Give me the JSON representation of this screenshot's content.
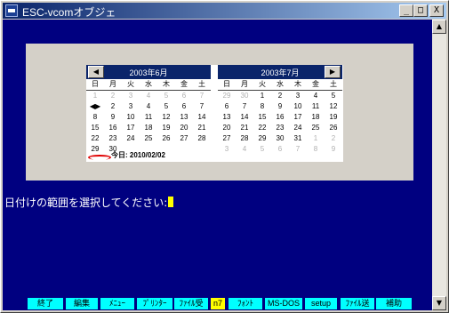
{
  "window": {
    "title": "ESC-vcomオブジェ",
    "min_glyph": "_",
    "max_glyph": "□",
    "close_glyph": "X"
  },
  "calendar": {
    "prev_glyph": "◀",
    "next_glyph": "▶",
    "weekdays": [
      "日",
      "月",
      "火",
      "水",
      "木",
      "金",
      "土"
    ],
    "months": [
      {
        "title": "2003年6月",
        "days": [
          {
            "d": "1"
          },
          {
            "d": "2"
          },
          {
            "d": "3"
          },
          {
            "d": "4"
          },
          {
            "d": "5"
          },
          {
            "d": "6"
          },
          {
            "d": "7"
          },
          {
            "d": "◀▶"
          },
          {
            "d": "2"
          },
          {
            "d": "3"
          },
          {
            "d": "4"
          },
          {
            "d": "5"
          },
          {
            "d": "6"
          },
          {
            "d": "7"
          },
          {
            "d": "8"
          },
          {
            "d": "9"
          },
          {
            "d": "10"
          },
          {
            "d": "11"
          },
          {
            "d": "12"
          },
          {
            "d": "13"
          },
          {
            "d": "14"
          },
          {
            "d": "15"
          },
          {
            "d": "16"
          },
          {
            "d": "17"
          },
          {
            "d": "18"
          },
          {
            "d": "19"
          },
          {
            "d": "20"
          },
          {
            "d": "21"
          },
          {
            "d": "22"
          },
          {
            "d": "23"
          },
          {
            "d": "24"
          },
          {
            "d": "25"
          },
          {
            "d": "26"
          },
          {
            "d": "27"
          },
          {
            "d": "28"
          },
          {
            "d": "29"
          },
          {
            "d": "30"
          }
        ],
        "dim_first_row": true
      },
      {
        "title": "2003年7月",
        "days": [
          {
            "d": "29"
          },
          {
            "d": "30"
          },
          {
            "d": "1"
          },
          {
            "d": "2"
          },
          {
            "d": "3"
          },
          {
            "d": "4"
          },
          {
            "d": "5"
          },
          {
            "d": "6"
          },
          {
            "d": "7"
          },
          {
            "d": "8"
          },
          {
            "d": "9"
          },
          {
            "d": "10"
          },
          {
            "d": "11"
          },
          {
            "d": "12"
          },
          {
            "d": "13"
          },
          {
            "d": "14"
          },
          {
            "d": "15"
          },
          {
            "d": "16"
          },
          {
            "d": "17"
          },
          {
            "d": "18"
          },
          {
            "d": "19"
          },
          {
            "d": "20"
          },
          {
            "d": "21"
          },
          {
            "d": "22"
          },
          {
            "d": "23"
          },
          {
            "d": "24"
          },
          {
            "d": "25"
          },
          {
            "d": "26"
          },
          {
            "d": "27"
          },
          {
            "d": "28"
          },
          {
            "d": "29"
          },
          {
            "d": "30"
          },
          {
            "d": "31"
          },
          {
            "d": "1"
          },
          {
            "d": "2"
          },
          {
            "d": "3"
          },
          {
            "d": "4"
          },
          {
            "d": "5"
          },
          {
            "d": "6"
          },
          {
            "d": "7"
          },
          {
            "d": "8"
          },
          {
            "d": "9"
          }
        ]
      }
    ],
    "today_label": "今日: 2010/02/02"
  },
  "prompt": {
    "text": "日付けの範囲を選択してください:"
  },
  "scroll": {
    "up_glyph": "▲",
    "down_glyph": "▼"
  },
  "function_keys": [
    {
      "label": "終了",
      "highlight": false
    },
    {
      "label": "編集",
      "highlight": false
    },
    {
      "label": "ﾒﾆｭｰ",
      "highlight": false
    },
    {
      "label": "ﾌﾟﾘﾝﾀｰ",
      "highlight": false
    },
    {
      "label": "ﾌｧｲﾙ受",
      "highlight": false
    },
    {
      "label": "n7",
      "highlight": true
    },
    {
      "label": "ﾌｫﾝﾄ",
      "highlight": false
    },
    {
      "label": "MS-DOS",
      "highlight": false
    },
    {
      "label": "setup",
      "highlight": false
    },
    {
      "label": "ﾌｧｲﾙ送",
      "highlight": false
    },
    {
      "label": "補助",
      "highlight": false
    }
  ]
}
